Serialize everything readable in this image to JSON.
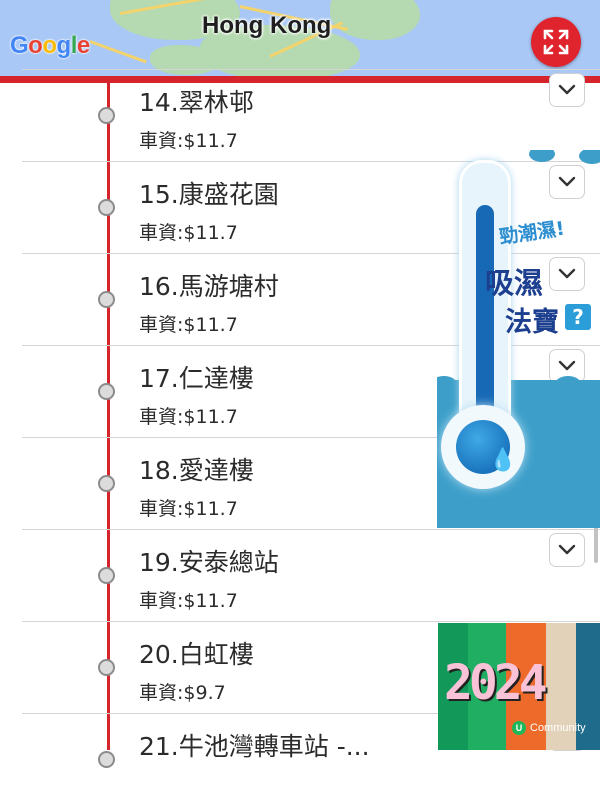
{
  "map": {
    "city_label": "Hong Kong",
    "logo_text": "Google",
    "logo_colors": [
      "#4285F4",
      "#EA4335",
      "#FBBC05",
      "#4285F4",
      "#34A853",
      "#EA4335"
    ],
    "expand_icon": "expand-arrows-icon",
    "accent_color": "#d6242d"
  },
  "stops": [
    {
      "name": "14.翠林邨",
      "fare": "車資:$11.7"
    },
    {
      "name": "15.康盛花園",
      "fare": "車資:$11.7"
    },
    {
      "name": "16.馬游塘村",
      "fare": "車資:$11.7"
    },
    {
      "name": "17.仁達樓",
      "fare": "車資:$11.7"
    },
    {
      "name": "18.愛達樓",
      "fare": "車資:$11.7"
    },
    {
      "name": "19.安泰總站",
      "fare": "車資:$11.7"
    },
    {
      "name": "20.白虹樓",
      "fare": "車資:$9.7"
    },
    {
      "name": "21.牛池灣轉車站 -...",
      "fare": ""
    }
  ],
  "ads": {
    "thermo": {
      "tag1": "勁潮濕!",
      "tag2": "吸濕",
      "tag3": "法寶",
      "qmark": "?"
    },
    "banner": {
      "big_text": "2024",
      "brand_badge": "U",
      "brand_text": "Community"
    }
  }
}
